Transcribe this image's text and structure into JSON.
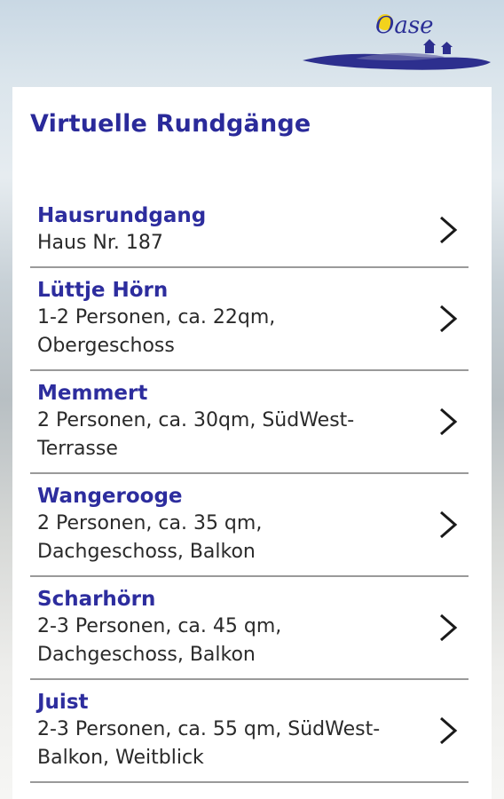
{
  "app": {
    "logo_text": "Oase"
  },
  "page": {
    "title": "Virtuelle Rundgänge"
  },
  "items": [
    {
      "title": "Hausrundgang",
      "desc_lines": [
        "Haus Nr. 187"
      ]
    },
    {
      "title": "Lüttje Hörn",
      "desc_lines": [
        "1-2 Personen, ca. 22qm,",
        "Obergeschoss"
      ]
    },
    {
      "title": "Memmert",
      "desc_lines": [
        "2 Personen, ca. 30qm, SüdWest-",
        "Terrasse"
      ]
    },
    {
      "title": "Wangerooge",
      "desc_lines": [
        "2 Personen, ca. 35 qm,",
        "Dachgeschoss, Balkon"
      ]
    },
    {
      "title": "Scharhörn",
      "desc_lines": [
        "2-3 Personen, ca. 45 qm,",
        "Dachgeschoss, Balkon"
      ]
    },
    {
      "title": "Juist",
      "desc_lines": [
        "2-3 Personen, ca. 55 qm, SüdWest-",
        "Balkon, Weitblick"
      ]
    }
  ],
  "colors": {
    "accent": "#2d2d9e",
    "text": "#2a2a2a",
    "divider": "#9a9a9a"
  },
  "icons": {
    "row_action": "chevron-right-icon"
  }
}
